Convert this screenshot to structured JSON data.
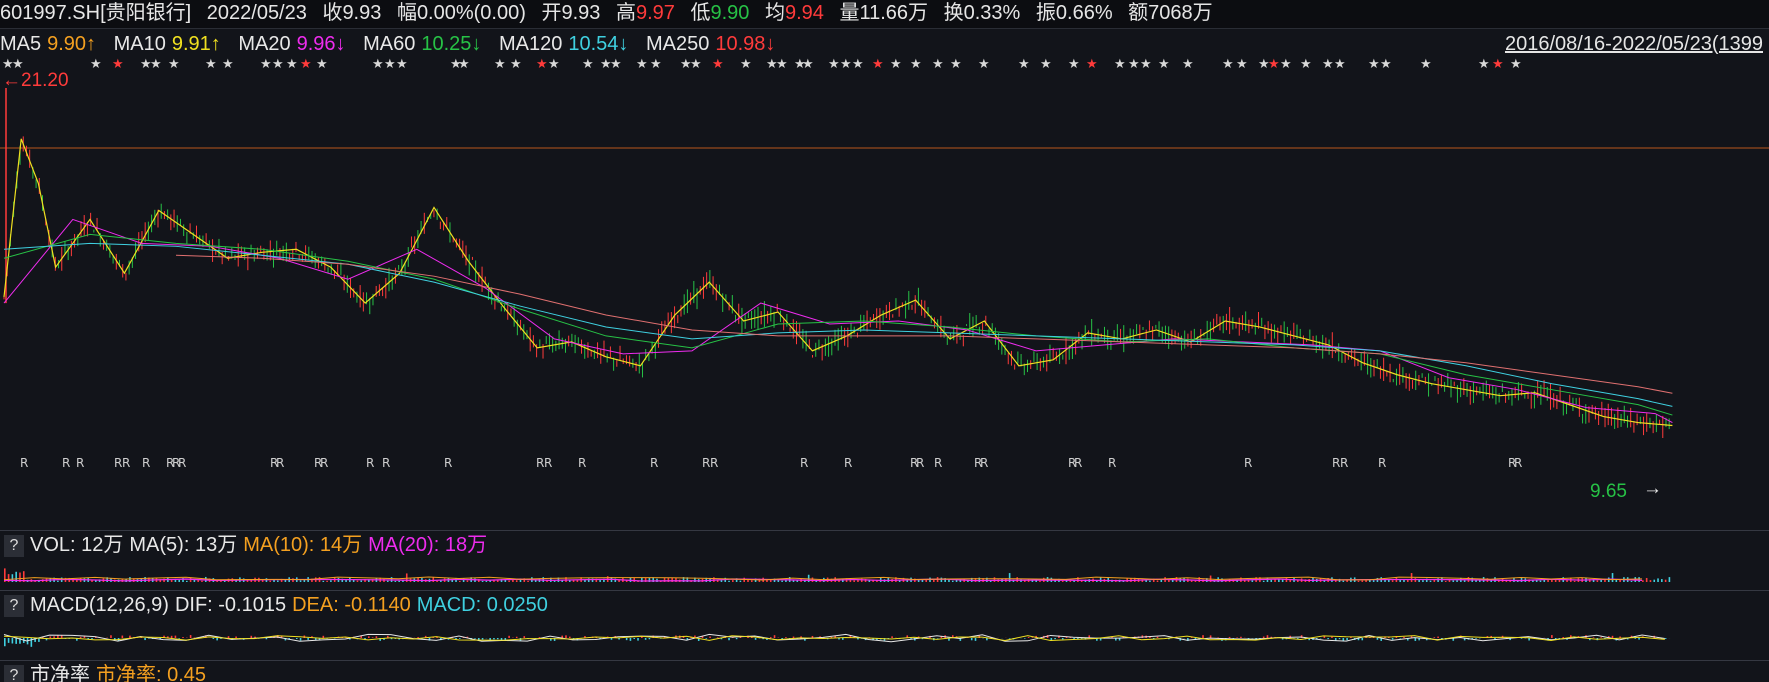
{
  "quote": {
    "code_name": "601997.SH[贵阳银行]",
    "date": "2022/05/23",
    "close_label": "收",
    "close": "9.93",
    "chg_label": "幅",
    "chg": "0.00%(0.00)",
    "open_label": "开",
    "open": "9.93",
    "high_label": "高",
    "high": "9.97",
    "low_label": "低",
    "low": "9.90",
    "avg_label": "均",
    "avg": "9.94",
    "vol_label": "量",
    "vol": "11.66万",
    "turnover_label": "换",
    "turnover": "0.33%",
    "amp_label": "振",
    "amp": "0.66%",
    "amount_label": "额",
    "amount": "7068万"
  },
  "ma_bar": {
    "items": [
      {
        "label": "MA5",
        "value": "9.90↑"
      },
      {
        "label": "MA10",
        "value": "9.91↑"
      },
      {
        "label": "MA20",
        "value": "9.96↓"
      },
      {
        "label": "MA60",
        "value": "10.25↓"
      },
      {
        "label": "MA120",
        "value": "10.54↓"
      },
      {
        "label": "MA250",
        "value": "10.98↓"
      }
    ],
    "date_range": "2016/08/16-2022/05/23(1399"
  },
  "annotations": {
    "max_label": "←21.20",
    "min_label": "9.65",
    "min_arrow": "→"
  },
  "vol_panel": {
    "btn": "?",
    "items": [
      {
        "label": "VOL: 12万"
      },
      {
        "label": "MA(5): 13万"
      },
      {
        "label": "MA(10): 14万"
      },
      {
        "label": "MA(20): 18万"
      }
    ]
  },
  "macd_panel": {
    "btn": "?",
    "items": [
      {
        "label": "MACD(12,26,9)"
      },
      {
        "label": "DIF: -0.1015"
      },
      {
        "label": "DEA: -0.1140"
      },
      {
        "label": "MACD: 0.0250"
      }
    ]
  },
  "pb_panel": {
    "btn": "?",
    "title": "市净率",
    "value": "市净率: 0.45"
  },
  "colors": {
    "background": "#12141a",
    "up": "#ff3b3b",
    "down": "#27c246",
    "ma5": "#f0e020",
    "ma10": "#f4a020",
    "ma20": "#ee2cee",
    "ma60": "#27c246",
    "ma120": "#3fd0e0",
    "ma250": "#e07070"
  },
  "chart_data": {
    "type": "line",
    "title": "",
    "x_range": [
      "2016/08/16",
      "2022/05/23"
    ],
    "price_range": [
      9.65,
      21.2
    ],
    "markers": {
      "star": "★",
      "r": "R"
    },
    "series": [
      {
        "name": "MA5",
        "x": [
          0,
          0.01,
          0.02,
          0.03,
          0.05,
          0.07,
          0.09,
          0.11,
          0.13,
          0.15,
          0.17,
          0.19,
          0.21,
          0.23,
          0.25,
          0.27,
          0.29,
          0.31,
          0.33,
          0.35,
          0.37,
          0.39,
          0.41,
          0.43,
          0.45,
          0.47,
          0.49,
          0.51,
          0.53,
          0.55,
          0.57,
          0.59,
          0.61,
          0.63,
          0.65,
          0.67,
          0.69,
          0.71,
          0.73,
          0.75,
          0.77,
          0.79,
          0.81,
          0.83,
          0.85,
          0.87,
          0.89,
          0.91,
          0.93,
          0.95,
          0.97
        ],
        "values": [
          14.2,
          19.5,
          18.0,
          15.2,
          16.8,
          15.0,
          17.1,
          16.3,
          15.5,
          15.7,
          15.8,
          15.2,
          14.0,
          15.0,
          17.2,
          15.4,
          13.9,
          12.5,
          12.7,
          12.2,
          11.9,
          13.6,
          14.7,
          13.4,
          13.7,
          12.4,
          12.9,
          13.6,
          14.1,
          12.8,
          13.4,
          11.9,
          12.1,
          13.0,
          12.8,
          13.1,
          12.7,
          13.4,
          13.2,
          12.9,
          12.6,
          12.0,
          11.6,
          11.3,
          11.1,
          10.9,
          11.0,
          10.6,
          10.2,
          10.0,
          9.9
        ]
      },
      {
        "name": "MA20",
        "x": [
          0,
          0.04,
          0.08,
          0.12,
          0.16,
          0.2,
          0.24,
          0.28,
          0.32,
          0.36,
          0.4,
          0.44,
          0.48,
          0.52,
          0.56,
          0.6,
          0.64,
          0.68,
          0.72,
          0.76,
          0.8,
          0.84,
          0.88,
          0.92,
          0.96,
          0.97
        ],
        "values": [
          14.0,
          16.8,
          16.0,
          15.9,
          15.5,
          14.8,
          15.8,
          14.5,
          12.8,
          12.3,
          12.4,
          14.0,
          13.3,
          13.4,
          13.1,
          12.4,
          12.6,
          12.8,
          12.7,
          12.6,
          12.4,
          11.5,
          11.1,
          10.5,
          10.3,
          10.0
        ]
      },
      {
        "name": "MA60",
        "x": [
          0,
          0.05,
          0.1,
          0.15,
          0.2,
          0.25,
          0.3,
          0.35,
          0.4,
          0.45,
          0.5,
          0.55,
          0.6,
          0.65,
          0.7,
          0.75,
          0.8,
          0.85,
          0.9,
          0.95,
          0.97
        ],
        "values": [
          15.5,
          16.3,
          16.0,
          15.8,
          15.4,
          14.8,
          13.8,
          12.9,
          12.5,
          13.3,
          13.4,
          13.2,
          12.9,
          12.7,
          12.8,
          12.5,
          12.3,
          11.6,
          11.1,
          10.6,
          10.25
        ]
      },
      {
        "name": "MA120",
        "x": [
          0,
          0.05,
          0.1,
          0.15,
          0.2,
          0.25,
          0.3,
          0.35,
          0.4,
          0.45,
          0.5,
          0.55,
          0.6,
          0.65,
          0.7,
          0.75,
          0.8,
          0.85,
          0.9,
          0.95,
          0.97
        ],
        "values": [
          15.8,
          16.0,
          15.9,
          15.6,
          15.3,
          14.7,
          13.9,
          13.2,
          12.8,
          13.0,
          13.1,
          13.0,
          12.9,
          12.8,
          12.7,
          12.6,
          12.4,
          11.9,
          11.3,
          10.8,
          10.54
        ]
      },
      {
        "name": "MA250",
        "x": [
          0.1,
          0.15,
          0.2,
          0.25,
          0.3,
          0.35,
          0.4,
          0.45,
          0.5,
          0.55,
          0.6,
          0.65,
          0.7,
          0.75,
          0.8,
          0.85,
          0.9,
          0.95,
          0.97
        ],
        "values": [
          15.6,
          15.5,
          15.3,
          14.9,
          14.3,
          13.6,
          13.1,
          12.9,
          12.9,
          12.9,
          12.8,
          12.7,
          12.6,
          12.5,
          12.3,
          12.0,
          11.6,
          11.2,
          10.98
        ]
      }
    ]
  }
}
